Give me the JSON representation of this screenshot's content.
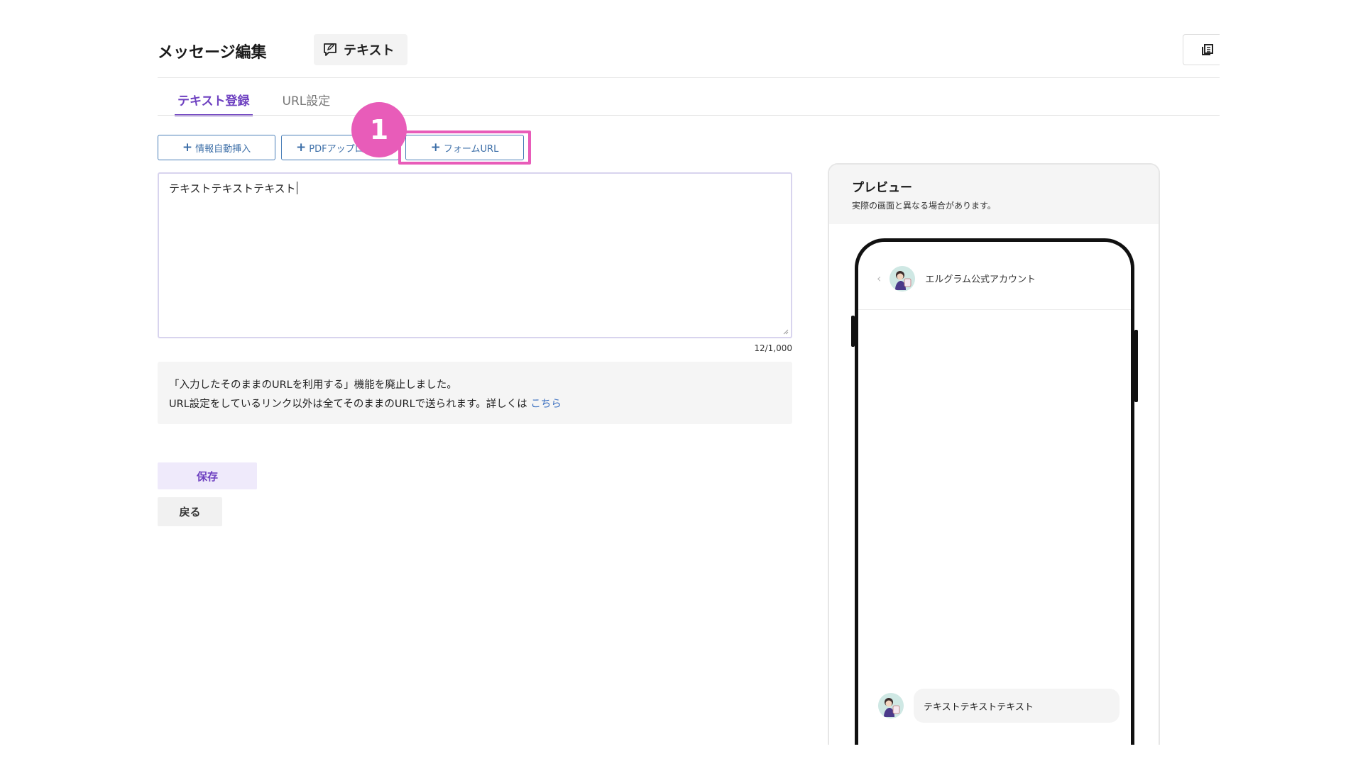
{
  "header": {
    "title": "メッセージ編集",
    "type_label": "テキスト",
    "type_icon": "chat-edit-icon",
    "corner_icon": "copy-list-icon"
  },
  "tabs": [
    {
      "label": "テキスト登録",
      "active": true
    },
    {
      "label": "URL設定",
      "active": false
    }
  ],
  "insert_buttons": [
    {
      "label": "情報自動挿入"
    },
    {
      "label": "PDFアップロ"
    },
    {
      "label": "フォームURL"
    }
  ],
  "step_badge": "1",
  "editor": {
    "value": "テキストテキストテキスト",
    "counter": "12/1,000"
  },
  "notice": {
    "line1": "「入力したそのままのURLを利用する」機能を廃止しました。",
    "line2": "URL設定をしているリンク以外は全てそのままのURLで送られます。詳しくは",
    "link": "こちら"
  },
  "actions": {
    "save": "保存",
    "back": "戻る"
  },
  "preview": {
    "title": "プレビュー",
    "subtitle": "実際の画面と異なる場合があります。",
    "account_name": "エルグラム公式アカウント",
    "message": "テキストテキストテキスト"
  },
  "colors": {
    "accent": "#6f42c1",
    "highlight": "#e85cb9",
    "button_border": "#4a7fb8",
    "link": "#3a6fc0"
  }
}
